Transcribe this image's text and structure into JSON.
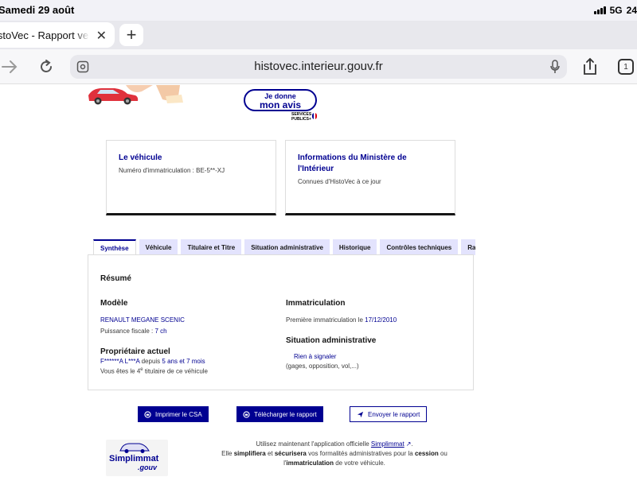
{
  "status_bar": {
    "date": "Samedi 29 août",
    "network": "5G",
    "battery": "24"
  },
  "browser": {
    "tab_title": "istoVec - Rapport vend",
    "url": "histovec.interieur.gouv.fr",
    "tab_count": "1"
  },
  "feedback": {
    "line1": "Je donne",
    "line2": "mon avis",
    "services_line1": "SERVICES",
    "services_line2": "PUBLICS+"
  },
  "cards": [
    {
      "title": "Le véhicule",
      "subtitle": "Numéro d'immatriculation : BE-5**-XJ"
    },
    {
      "title": "Informations du Ministère de l'Intérieur",
      "subtitle": "Connues d'HistoVec à ce jour"
    }
  ],
  "report_tabs": [
    "Synthèse",
    "Véhicule",
    "Titulaire et Titre",
    "Situation administrative",
    "Historique",
    "Contrôles techniques",
    "Ra"
  ],
  "summary": {
    "heading": "Résumé",
    "model_heading": "Modèle",
    "model_name": "RENAULT MEGANE SCENIC",
    "fiscal_label": "Puissance fiscale : ",
    "fiscal_value": "7 ch",
    "owner_heading": "Propriétaire actuel",
    "owner_name": "F******A L***A",
    "owner_since_label": " depuis ",
    "owner_since_value": "5 ans et 7 mois",
    "holder_prefix": "Vous êtes le ",
    "holder_rank": "4",
    "holder_sup": "e",
    "holder_suffix": " titulaire de ce véhicule",
    "registration_heading": "Immatriculation",
    "registration_label": "Première immatriculation le ",
    "registration_date": "17/12/2010",
    "admin_heading": "Situation administrative",
    "admin_status": "Rien à signaler",
    "admin_detail": "(gages, opposition, vol,...)"
  },
  "actions": {
    "print": "Imprimer le CSA",
    "download": "Télécharger le rapport",
    "send": "Envoyer le rapport"
  },
  "simplimmat": {
    "logo_word": "Simplimmat",
    "logo_suffix": ".gouv",
    "line1_prefix": "Utilisez maintenant l'application officielle ",
    "link": "Simplimmat",
    "line1_suffix": ".",
    "line2_a": "Elle ",
    "line2_b": "simplifiera",
    "line2_c": " et ",
    "line2_d": "sécurisera",
    "line2_e": " vos formalités administratives pour la ",
    "line2_f": "cession",
    "line2_g": " ou",
    "line3_a": "l'",
    "line3_b": "immatriculation",
    "line3_c": " de votre véhicule."
  }
}
